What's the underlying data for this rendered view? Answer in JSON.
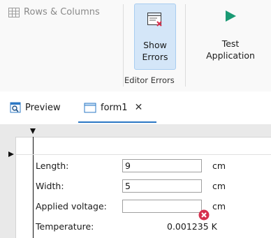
{
  "ribbon": {
    "rows_columns_label": "Rows & Columns",
    "show_errors_line1": "Show",
    "show_errors_line2": "Errors",
    "group_label": "Editor Errors",
    "test_app_line1": "Test",
    "test_app_line2": "Application"
  },
  "tabs": [
    {
      "label": "Preview",
      "icon": "preview-icon"
    },
    {
      "label": "form1",
      "icon": "form-icon",
      "active": true,
      "close": "✕"
    }
  ],
  "form": {
    "rows": [
      {
        "label": "Length:",
        "value": "9",
        "unit": "cm"
      },
      {
        "label": "Width:",
        "value": "5",
        "unit": "cm"
      },
      {
        "label": "Applied voltage:",
        "value": "",
        "unit": "cm"
      },
      {
        "label": "Temperature:",
        "readout": "0.001235 K"
      }
    ]
  },
  "colors": {
    "accent": "#2b78c5",
    "error": "#d6304d",
    "play": "#1a9a74",
    "selected_button_bg": "#d4e6f8"
  }
}
